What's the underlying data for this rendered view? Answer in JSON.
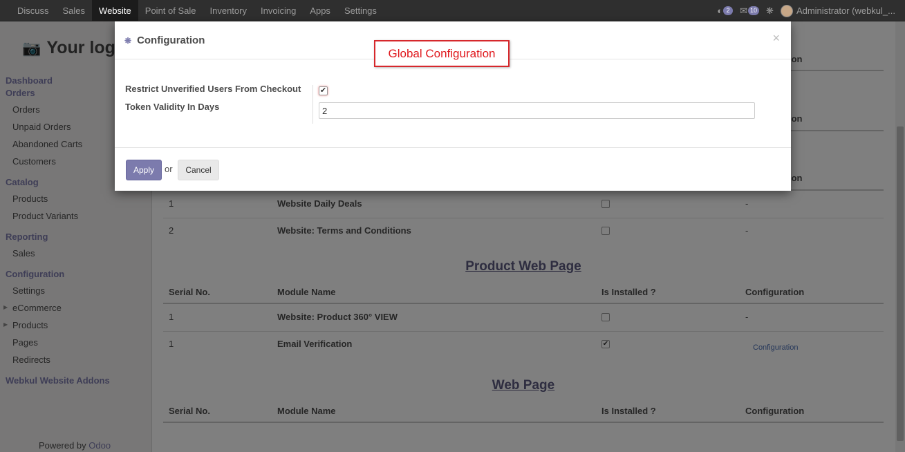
{
  "topbar": {
    "menu": [
      "Discuss",
      "Sales",
      "Website",
      "Point of Sale",
      "Inventory",
      "Invoicing",
      "Apps",
      "Settings"
    ],
    "active_index": 2,
    "chat_count": "2",
    "msg_count": "10",
    "user": "Administrator (webkul_..."
  },
  "sidebar": {
    "logo": "Your log",
    "sections": {
      "dashboard": "Dashboard",
      "orders": "Orders",
      "catalog": "Catalog",
      "reporting": "Reporting",
      "configuration": "Configuration",
      "addons": "Webkul Website Addons"
    },
    "items": {
      "orders": "Orders",
      "unpaid": "Unpaid Orders",
      "abandoned": "Abandoned Carts",
      "customers": "Customers",
      "products": "Products",
      "variants": "Product Variants",
      "sales": "Sales",
      "settings": "Settings",
      "ecommerce": "eCommerce",
      "products2": "Products",
      "pages": "Pages",
      "redirects": "Redirects"
    },
    "powered_prefix": "Powered by ",
    "powered_brand": "Odoo"
  },
  "main": {
    "headers": {
      "serial": "Serial No.",
      "module": "Module Name",
      "installed": "Is Installed ?",
      "config": "Configuration"
    },
    "top_rows": [
      {
        "serial": "1",
        "module": "Website Daily Deals",
        "installed": false,
        "config": "-"
      },
      {
        "serial": "2",
        "module": "Website: Terms and Conditions",
        "installed": false,
        "config": "-"
      }
    ],
    "section_product": "Product Web Page",
    "product_rows": [
      {
        "serial": "1",
        "module": "Website: Product 360° VIEW",
        "installed": false,
        "config": "-"
      },
      {
        "serial": "1",
        "module": "Email Verification",
        "installed": true,
        "config": "Configuration"
      }
    ],
    "section_web": "Web Page",
    "partial_headers": [
      "ion",
      "ion",
      "ion"
    ]
  },
  "modal": {
    "title": "Configuration",
    "callout": "Global Configuration",
    "fields": {
      "restrict_label": "Restrict Unverified Users From Checkout",
      "restrict_checked": true,
      "token_label": "Token Validity In Days",
      "token_value": "2"
    },
    "apply_label": "Apply",
    "or_label": "or",
    "cancel_label": "Cancel"
  }
}
